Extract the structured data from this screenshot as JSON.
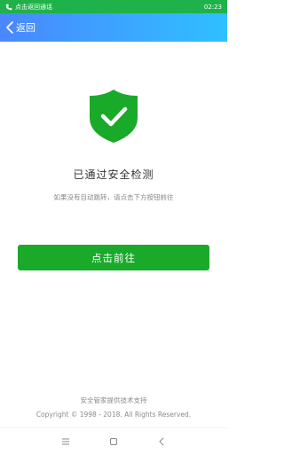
{
  "status_bar": {
    "call_text": "点击返回通话",
    "time": "02:23"
  },
  "nav": {
    "back_label": "返回"
  },
  "main": {
    "title": "已通过安全检测",
    "subtitle": "如果没有自动跳转，请点击下方按钮前往",
    "go_button_label": "点击前往"
  },
  "footer": {
    "support": "安全管家提供技术支持",
    "copyright": "Copyright © 1998 - 2018. All Rights Reserved."
  },
  "colors": {
    "status_bar": "#1fb24a",
    "nav_gradient_start": "#4a87ff",
    "nav_gradient_end": "#2fc0ff",
    "shield": "#1aaa2a",
    "button": "#1aaa2a"
  },
  "icons": {
    "status_call": "phone-icon",
    "back": "chevron-left-icon",
    "shield": "shield-check-icon",
    "menu": "menu-icon",
    "home": "home-square-icon",
    "system_back": "back-arrow-icon"
  }
}
